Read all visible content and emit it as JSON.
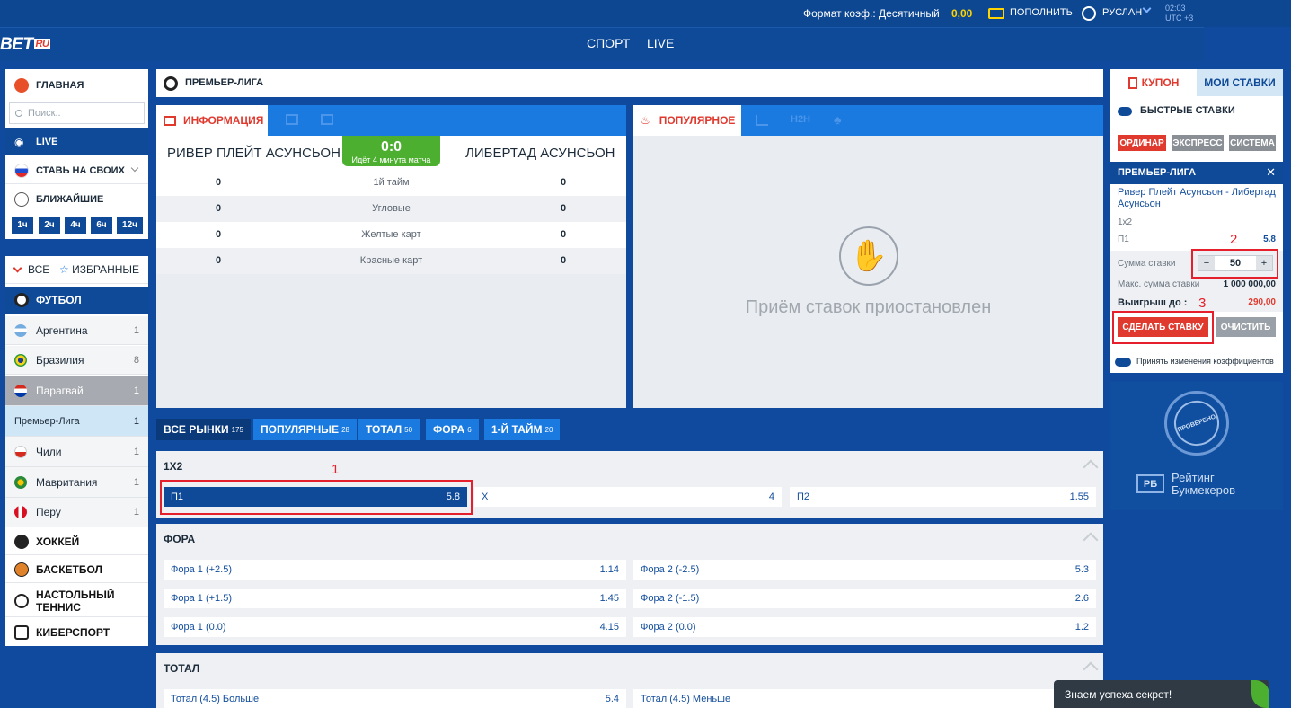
{
  "header": {
    "odds_format": "Формат коэф.: Десятичный",
    "balance": "0,00",
    "deposit": "ПОПОЛНИТЬ",
    "user": "РУСЛАН",
    "time": "02:03",
    "tz": "UTC +3"
  },
  "logo": {
    "text": "BET",
    "suffix": "RU"
  },
  "nav": {
    "sport": "СПОРТ",
    "live": "LIVE"
  },
  "sidebar": {
    "home": "ГЛАВНАЯ",
    "search_placeholder": "Поиск..",
    "live": "LIVE",
    "own": "СТАВЬ НА СВОИХ",
    "nearest": "БЛИЖАЙШИЕ",
    "hours": [
      "1ч",
      "2ч",
      "4ч",
      "6ч",
      "12ч"
    ],
    "all": "ВСЕ",
    "favorites": "ИЗБРАННЫЕ",
    "football": "ФУТБОЛ",
    "countries": [
      {
        "name": "Аргентина",
        "count": "1"
      },
      {
        "name": "Бразилия",
        "count": "8"
      },
      {
        "name": "Парагвай",
        "count": "1"
      },
      {
        "name": "Премьер-Лига",
        "count": "1"
      },
      {
        "name": "Чили",
        "count": "1"
      },
      {
        "name": "Мавритания",
        "count": "1"
      },
      {
        "name": "Перу",
        "count": "1"
      }
    ],
    "sports": [
      "ХОККЕЙ",
      "БАСКЕТБОЛ",
      "НАСТОЛЬНЫЙ ТЕННИС",
      "КИБЕРСПОРТ"
    ]
  },
  "league": {
    "title": "ПРЕМЬЕР-ЛИГА"
  },
  "info": {
    "tab": "ИНФОРМАЦИЯ",
    "home_team": "РИВЕР ПЛЕЙТ АСУНСЬОН",
    "away_team": "ЛИБЕРТАД АСУНСЬОН",
    "score": "0:0",
    "status": "Идёт 4 минута матча",
    "stats": [
      {
        "home": "0",
        "label": "1й тайм",
        "away": "0"
      },
      {
        "home": "0",
        "label": "Угловые",
        "away": "0"
      },
      {
        "home": "0",
        "label": "Желтые карт",
        "away": "0"
      },
      {
        "home": "0",
        "label": "Красные карт",
        "away": "0"
      }
    ]
  },
  "popular": {
    "tab": "ПОПУЛЯРНОЕ",
    "h2h": "H2H",
    "suspended": "Приём ставок приостановлен"
  },
  "markets_tabs": [
    {
      "label": "ВСЕ РЫНКИ",
      "count": "175"
    },
    {
      "label": "ПОПУЛЯРНЫЕ",
      "count": "28"
    },
    {
      "label": "ТОТАЛ",
      "count": "50"
    },
    {
      "label": "ФОРА",
      "count": "6"
    },
    {
      "label": "1-Й ТАЙМ",
      "count": "20"
    }
  ],
  "market_1x2": {
    "title": "1X2",
    "odds": [
      {
        "label": "П1",
        "value": "5.8"
      },
      {
        "label": "X",
        "value": "4"
      },
      {
        "label": "П2",
        "value": "1.55"
      }
    ]
  },
  "market_fora": {
    "title": "ФОРА",
    "rows": [
      [
        {
          "label": "Фора 1 (+2.5)",
          "value": "1.14"
        },
        {
          "label": "Фора 2 (-2.5)",
          "value": "5.3"
        }
      ],
      [
        {
          "label": "Фора 1 (+1.5)",
          "value": "1.45"
        },
        {
          "label": "Фора 2 (-1.5)",
          "value": "2.6"
        }
      ],
      [
        {
          "label": "Фора 1 (0.0)",
          "value": "4.15"
        },
        {
          "label": "Фора 2 (0.0)",
          "value": "1.2"
        }
      ]
    ]
  },
  "market_total": {
    "title": "ТОТАЛ",
    "rows": [
      [
        {
          "label": "Тотал (4.5) Больше",
          "value": "5.4"
        },
        {
          "label": "Тотал (4.5) Меньше",
          "value": ""
        }
      ]
    ]
  },
  "coupon": {
    "tab_coupon": "КУПОН",
    "tab_mybets": "МОИ СТАВКИ",
    "quick": "БЫСТРЫЕ СТАВКИ",
    "types": [
      "ОРДИНАР",
      "ЭКСПРЕСС",
      "СИСТЕМА"
    ],
    "league": "ПРЕМЬЕР-ЛИГА",
    "match": "Ривер Плейт Асунсьон - Либертад Асунсьон",
    "market": "1x2",
    "pick": "П1",
    "pick_odds": "5.8",
    "stake_label": "Сумма ставки",
    "stake": "50",
    "max_label": "Макс. сумма ставки",
    "max_value": "1 000 000,00",
    "win_label": "Выигрыш до :",
    "win_value": "290,00",
    "place": "СДЕЛАТЬ СТАВКУ",
    "clear": "ОЧИСТИТЬ",
    "accept": "Принять изменения коэффициентов"
  },
  "rating": {
    "verified": "ПРОВЕРЕНО",
    "line1": "Рейтинг",
    "line2": "Букмекеров"
  },
  "annotations": [
    "1",
    "2",
    "3"
  ],
  "chat": {
    "text": "Знаем успеха секрет!"
  },
  "colors": {
    "accent": "#e03a2f",
    "primary": "#0e4a98",
    "tab_blue": "#1a7ae0",
    "live_green": "#4caf2f"
  }
}
